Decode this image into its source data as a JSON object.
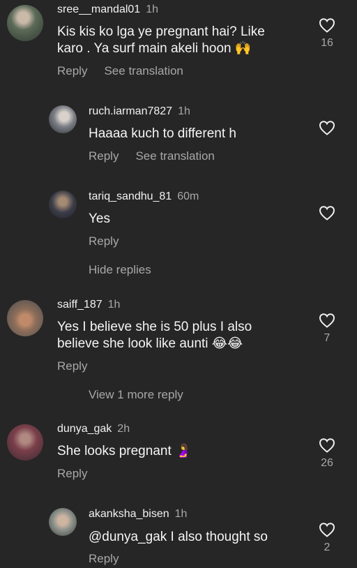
{
  "colors": {
    "background": "#262626",
    "text": "#f5f5f5",
    "muted": "#a8a8a8"
  },
  "icons": {
    "like": "heart-outline-icon"
  },
  "comments": [
    {
      "username": "sree__mandal01",
      "time": "1h",
      "text_lines": [
        "Kis kis ko lga ye pregnant hai? Like",
        "karo . Ya surf main akeli hoon 🙌"
      ],
      "reply": "Reply",
      "translate": "See translation",
      "likes": "16"
    },
    {
      "username": "ruch.iarman7827",
      "time": "1h",
      "text_lines": [
        "Haaaa kuch to different h"
      ],
      "reply": "Reply",
      "translate": "See translation",
      "likes": ""
    },
    {
      "username": "tariq_sandhu_81",
      "time": "60m",
      "text_lines": [
        "Yes"
      ],
      "reply": "Reply",
      "likes": ""
    },
    {
      "username": "saiff_187",
      "time": "1h",
      "text_lines": [
        "Yes I believe she is 50 plus I also",
        "believe she look like aunti 😂😂"
      ],
      "reply": "Reply",
      "likes": "7"
    },
    {
      "username": "dunya_gak",
      "time": "2h",
      "text_lines": [
        "She looks pregnant 🤰"
      ],
      "reply": "Reply",
      "likes": "26"
    },
    {
      "username": "akanksha_bisen",
      "time": "1h",
      "text_lines": [
        "@dunya_gak I also thought so"
      ],
      "reply": "Reply",
      "likes": "2"
    }
  ],
  "hide_replies": "Hide replies",
  "view_more": "View 1 more reply"
}
